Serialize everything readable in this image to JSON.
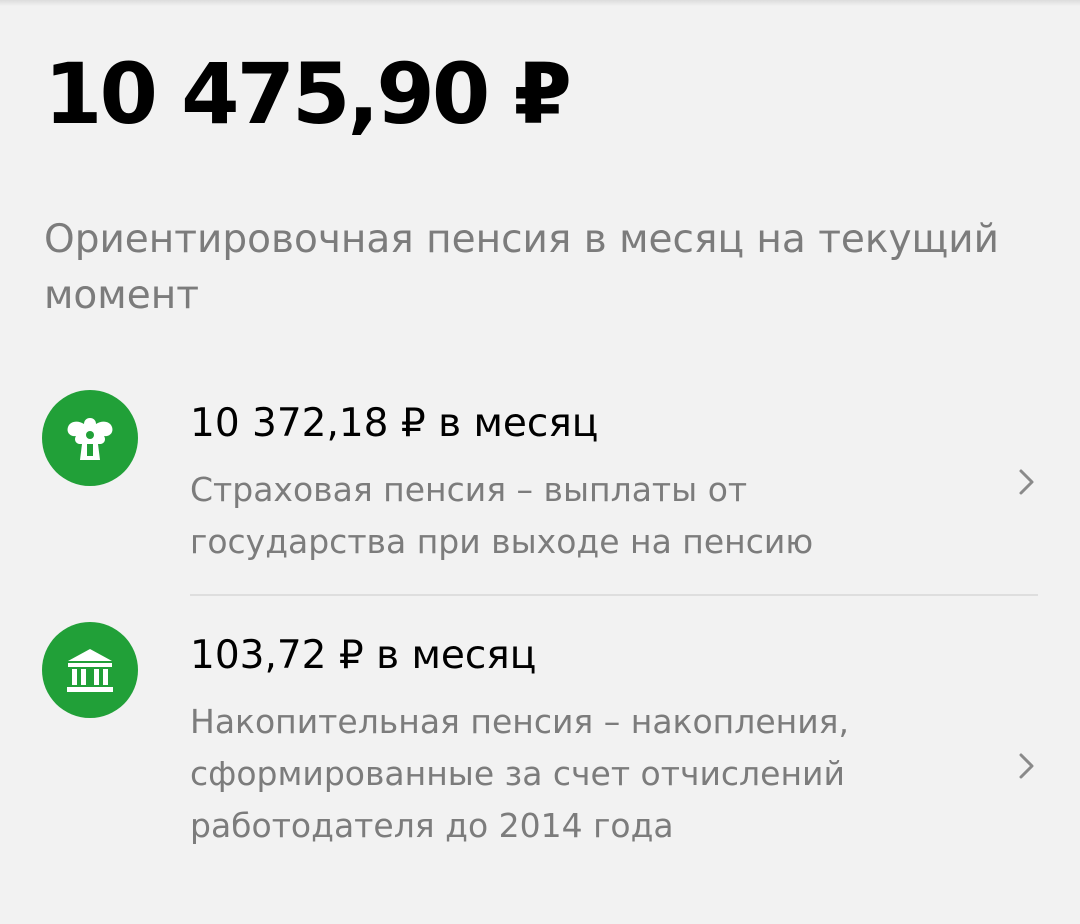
{
  "summary": {
    "total_amount": "10 475,90 ₽",
    "description": "Ориентировочная пенсия в месяц на текущий момент"
  },
  "items": [
    {
      "title": "10 372,18 ₽ в месяц",
      "description": "Страховая пенсия – выплаты от государства при выходе на пенсию",
      "icon": "emblem-icon"
    },
    {
      "title": "103,72 ₽ в месяц",
      "description": "Накопительная пенсия – накопления, сформированные за счет отчислений работодателя до 2014 года",
      "icon": "bank-building-icon"
    }
  ],
  "colors": {
    "accent": "#21a038",
    "background": "#f2f2f2",
    "secondary_text": "#7c7c7c"
  }
}
